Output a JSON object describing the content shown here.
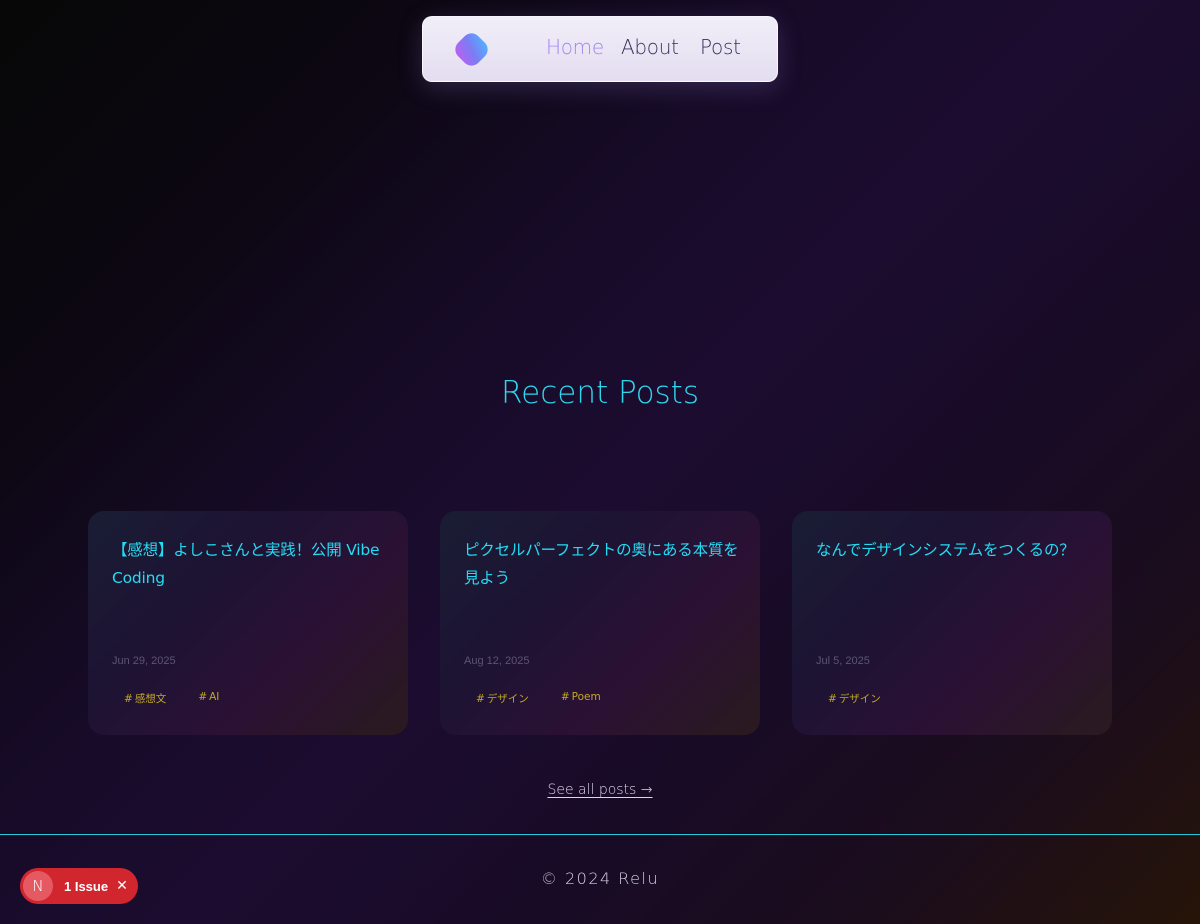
{
  "nav": {
    "logo_icon": "gradient-diamond-logo",
    "links": [
      {
        "label": "Home",
        "active": true
      },
      {
        "label": "About",
        "active": false
      },
      {
        "label": "Post",
        "active": false
      }
    ]
  },
  "recent": {
    "title": "Recent Posts",
    "posts": [
      {
        "title": "【感想】よしこさんと実践！公開 Vibe Coding",
        "date": "Jun 29, 2025",
        "tags": [
          "感想文",
          "AI"
        ]
      },
      {
        "title": "ピクセルパーフェクトの奥にある本質を見よう",
        "date": "Aug 12, 2025",
        "tags": [
          "デザイン",
          "Poem"
        ]
      },
      {
        "title": "なんでデザインシステムをつくるの？",
        "date": "Jul 5, 2025",
        "tags": [
          "デザイン"
        ]
      }
    ],
    "see_all": "See all posts →"
  },
  "footer": {
    "copyright": "© 2024 Relu"
  },
  "dev_overlay": {
    "badge_letter": "N",
    "issue_label": "1 Issue",
    "close_icon": "close-icon"
  },
  "colors": {
    "accent_cyan": "#2ed6ee",
    "nav_active": "#a285f3",
    "tag_gold": "#c2a826",
    "issue_red": "#d2262f"
  }
}
